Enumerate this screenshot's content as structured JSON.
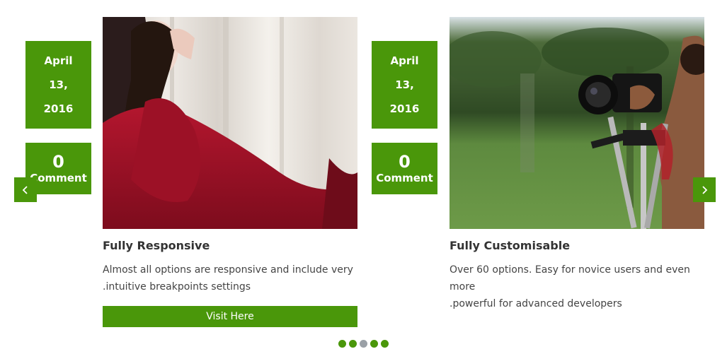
{
  "slides": [
    {
      "date": {
        "month": "April",
        "day": "13,",
        "year": "2016"
      },
      "comments": {
        "count": "0",
        "label": "Comment"
      },
      "title": "Fully Responsive",
      "desc_line1": "Almost all options are responsive and include very",
      "desc_line2": ".intuitive breakpoints settings",
      "button_label": "Visit Here"
    },
    {
      "date": {
        "month": "April",
        "day": "13,",
        "year": "2016"
      },
      "comments": {
        "count": "0",
        "label": "Comment"
      },
      "title": "Fully Customisable",
      "desc_line1": "Over 60 options. Easy for novice users and even more",
      "desc_line2": ".powerful for advanced developers"
    }
  ],
  "navigation": {
    "prev_icon": "chevron-left-icon",
    "next_icon": "chevron-right-icon",
    "dot_count": 5,
    "active_dot": 2
  },
  "colors": {
    "accent": "#4a970a",
    "inactive_dot": "#9aa0a6"
  }
}
